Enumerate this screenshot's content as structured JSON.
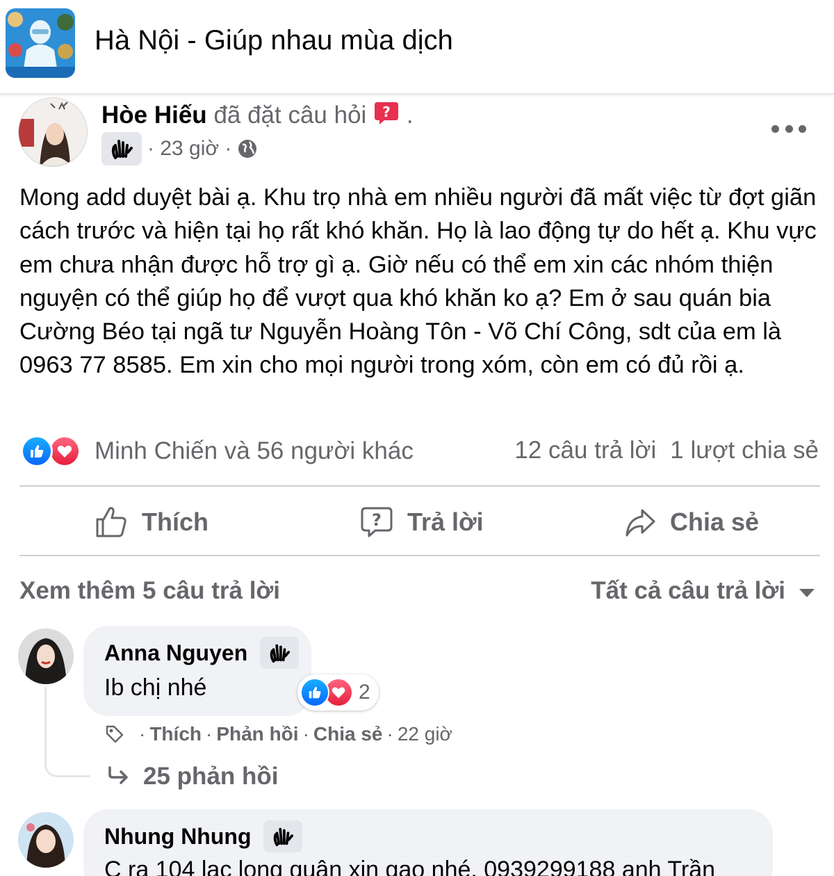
{
  "group": {
    "title": "Hà Nội - Giúp nhau mùa dịch"
  },
  "post": {
    "author": "Hòe Hiếu",
    "action_text": "đã đặt câu hỏi",
    "trailing_dot": ".",
    "time": "· 23 giờ ·",
    "text": "Mong add duyệt bài ạ. Khu trọ nhà em nhiều người đã mất việc từ đợt giãn cách trước và hiện tại họ rất khó khăn. Họ là lao động tự do hết ạ. Khu vực em chưa nhận được hỗ trợ gì ạ. Giờ nếu có thể em xin các nhóm thiện nguyện có thể giúp họ để vượt qua khó khăn ko ạ? Em ở sau quán bia Cường Béo tại ngã tư Nguyễn Hoàng Tôn - Võ Chí Công, sdt của em là 0963 77 8585. Em xin cho mọi người trong xóm, còn em có đủ rồi ạ.",
    "reaction_names": "Minh Chiến và 56 người khác",
    "answers_count": "12 câu trả lời",
    "shares_count": "1 lượt chia sẻ"
  },
  "actions": {
    "like": "Thích",
    "reply": "Trả lời",
    "share": "Chia sẻ"
  },
  "comments_bar": {
    "see_more": "Xem thêm 5 câu trả lời",
    "sort": "Tất cả câu trả lời"
  },
  "comments": [
    {
      "name": "Anna Nguyen",
      "text": "Ib chị nhé",
      "reaction_count": "2",
      "like": "Thích",
      "reply": "Phản hồi",
      "share": "Chia sẻ",
      "time": "22 giờ",
      "replies": "25 phản hồi"
    },
    {
      "name": "Nhung Nhung",
      "text": "C ra 104 lạc long quân xin gạo nhé. 0939299188 anh Trần"
    }
  ],
  "colors": {
    "secondary_text": "#65676b",
    "like_blue": "#0866ff",
    "love_red": "#f02849",
    "divider": "#ced0d4",
    "bubble": "#f0f2f5"
  }
}
